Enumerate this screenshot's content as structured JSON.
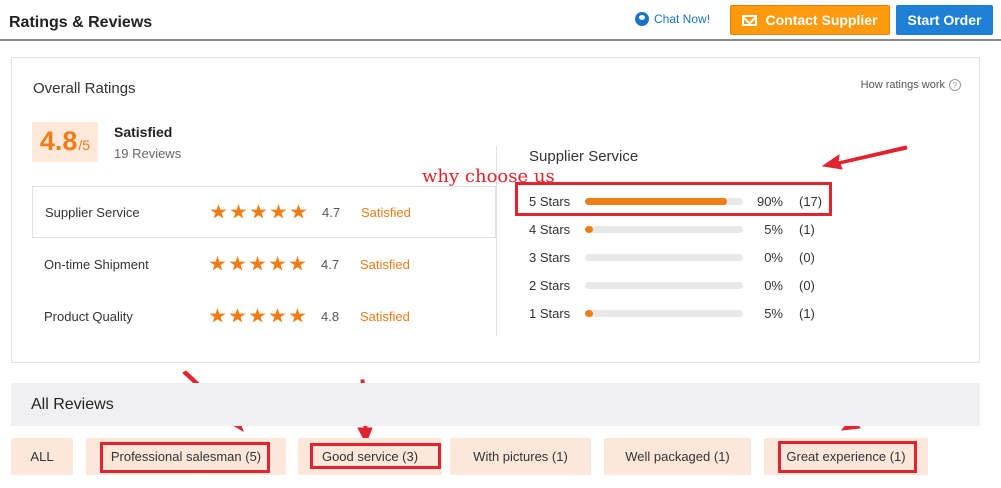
{
  "header": {
    "title": "Ratings & Reviews",
    "chat_label": "Chat Now!",
    "contact_label": "Contact Supplier",
    "order_label": "Start Order"
  },
  "overall": {
    "title": "Overall Ratings",
    "how_ratings": "How ratings work",
    "score": "4.8",
    "score_max": "/5",
    "status": "Satisfied",
    "review_count": "19 Reviews",
    "metrics": [
      {
        "label": "Supplier Service",
        "stars": 4.7,
        "score": "4.7",
        "status": "Satisfied"
      },
      {
        "label": "On-time Shipment",
        "stars": 4.7,
        "score": "4.7",
        "status": "Satisfied"
      },
      {
        "label": "Product Quality",
        "stars": 4.8,
        "score": "4.8",
        "status": "Satisfied"
      }
    ]
  },
  "supplier_service": {
    "title": "Supplier Service",
    "annotation": "why choose us",
    "distribution": [
      {
        "label": "5  Stars",
        "fraction": 0.9,
        "pct": "90%",
        "count": "(17)"
      },
      {
        "label": "4  Stars",
        "fraction": 0.05,
        "pct": "5%",
        "count": "(1)"
      },
      {
        "label": "3  Stars",
        "fraction": 0.0,
        "pct": "0%",
        "count": "(0)"
      },
      {
        "label": "2  Stars",
        "fraction": 0.0,
        "pct": "0%",
        "count": "(0)"
      },
      {
        "label": "1  Stars",
        "fraction": 0.05,
        "pct": "5%",
        "count": "(1)"
      }
    ]
  },
  "reviews": {
    "title": "All Reviews",
    "filters": [
      {
        "label": "ALL"
      },
      {
        "label": "Professional salesman (5)"
      },
      {
        "label": "Good service (3)"
      },
      {
        "label": "With pictures (1)"
      },
      {
        "label": "Well packaged (1)"
      },
      {
        "label": "Great experience (1)"
      }
    ]
  },
  "colors": {
    "accent": "#f07c16",
    "contact_button": "#ff9a0f",
    "order_button": "#1f7fd6",
    "annotation_red": "#e3232e"
  }
}
